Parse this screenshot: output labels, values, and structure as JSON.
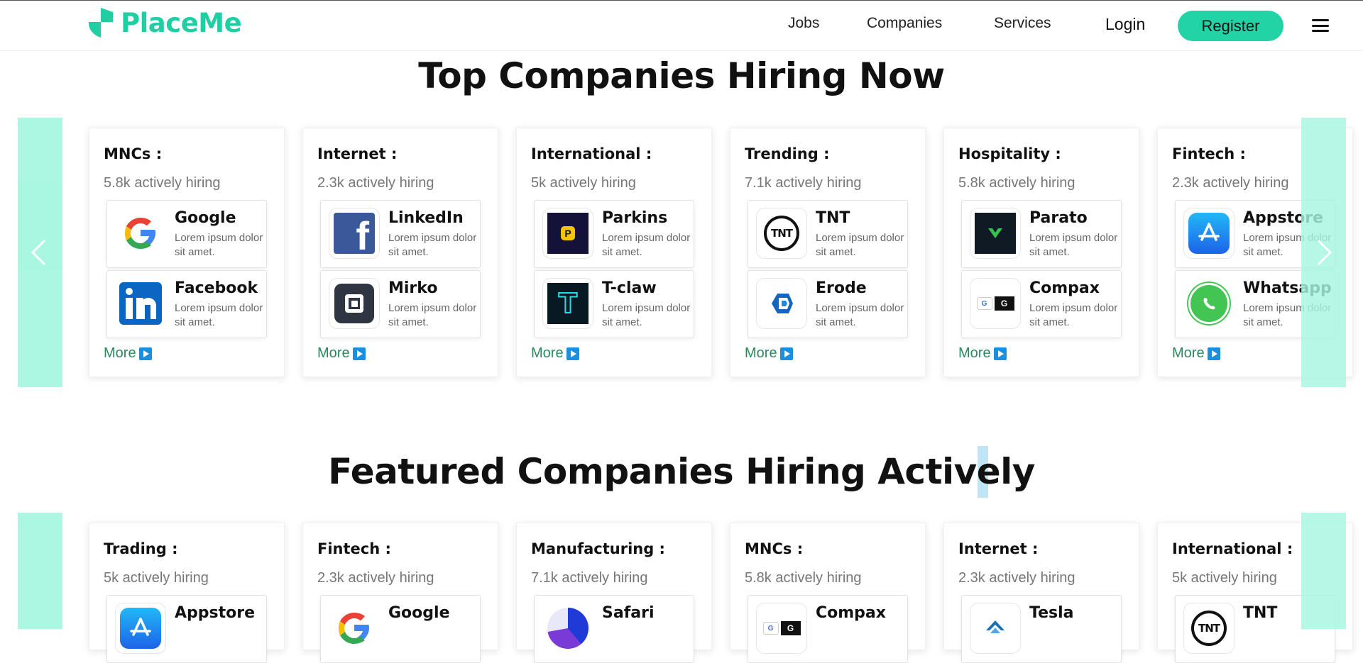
{
  "header": {
    "brand": "PlaceMe",
    "nav": [
      "Jobs",
      "Companies",
      "Services"
    ],
    "login": "Login",
    "register": "Register",
    "menu_icon": "hamburger-icon",
    "brand_color": "#1fcfa3"
  },
  "section1": {
    "title": "Top Companies Hiring Now",
    "cards": [
      {
        "category": "MNCs :",
        "hiring": "5.8k actively hiring",
        "companies": [
          {
            "name": "Google",
            "desc": "Lorem ipsum dolor sit amet.",
            "icon": "google-logo"
          },
          {
            "name": "Facebook",
            "desc": "Lorem ipsum dolor sit amet.",
            "icon": "linkedin-logo"
          }
        ],
        "more": "More"
      },
      {
        "category": "Internet :",
        "hiring": "2.3k actively hiring",
        "companies": [
          {
            "name": "LinkedIn",
            "desc": "Lorem ipsum dolor sit amet.",
            "icon": "facebook-logo"
          },
          {
            "name": "Mirko",
            "desc": "Lorem ipsum dolor sit amet.",
            "icon": "square-logo"
          }
        ],
        "more": "More"
      },
      {
        "category": "International :",
        "hiring": "5k actively hiring",
        "companies": [
          {
            "name": "Parkins",
            "desc": "Lorem ipsum dolor sit amet.",
            "icon": "parkins-logo"
          },
          {
            "name": "T-claw",
            "desc": "Lorem ipsum dolor sit amet.",
            "icon": "tclaw-logo"
          }
        ],
        "more": "More"
      },
      {
        "category": "Trending :",
        "hiring": "7.1k actively hiring",
        "companies": [
          {
            "name": "TNT",
            "desc": "Lorem ipsum dolor sit amet.",
            "icon": "tnt-logo"
          },
          {
            "name": "Erode",
            "desc": "Lorem ipsum dolor sit amet.",
            "icon": "erode-logo"
          }
        ],
        "more": "More"
      },
      {
        "category": "Hospitality :",
        "hiring": "5.8k actively hiring",
        "companies": [
          {
            "name": "Parato",
            "desc": "Lorem ipsum dolor sit amet.",
            "icon": "parato-logo"
          },
          {
            "name": "Compax",
            "desc": "Lorem ipsum dolor sit amet.",
            "icon": "compax-logo"
          }
        ],
        "more": "More"
      },
      {
        "category": "Fintech :",
        "hiring": "2.3k actively hiring",
        "companies": [
          {
            "name": "Appstore",
            "desc": "Lorem ipsum dolor sit amet.",
            "icon": "appstore-logo"
          },
          {
            "name": "Whatsapp",
            "desc": "Lorem ipsum dolor sit amet.",
            "icon": "whatsapp-logo"
          }
        ],
        "more": "More"
      }
    ]
  },
  "section2": {
    "title": "Featured Companies Hiring Actively",
    "cards": [
      {
        "category": "Trading :",
        "hiring": "5k actively hiring",
        "companies": [
          {
            "name": "Appstore",
            "icon": "appstore-logo"
          }
        ]
      },
      {
        "category": "Fintech :",
        "hiring": "2.3k actively hiring",
        "companies": [
          {
            "name": "Google",
            "icon": "google-logo"
          }
        ]
      },
      {
        "category": "Manufacturing :",
        "hiring": "7.1k actively hiring",
        "companies": [
          {
            "name": "Safari",
            "icon": "safari-logo"
          }
        ]
      },
      {
        "category": "MNCs :",
        "hiring": "5.8k actively hiring",
        "companies": [
          {
            "name": "Compax",
            "icon": "compax-logo"
          }
        ]
      },
      {
        "category": "Internet :",
        "hiring": "2.3k actively hiring",
        "companies": [
          {
            "name": "Tesla",
            "icon": "tesla-logo"
          }
        ]
      },
      {
        "category": "International :",
        "hiring": "5k actively hiring",
        "companies": [
          {
            "name": "TNT",
            "icon": "tnt-logo"
          }
        ]
      }
    ]
  }
}
